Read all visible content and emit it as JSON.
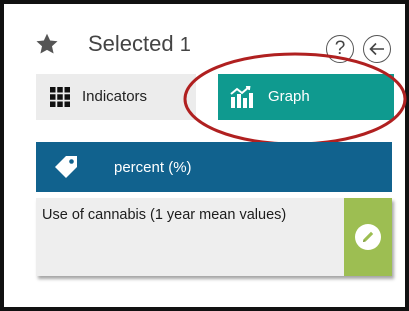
{
  "header": {
    "title": "Selected",
    "count": "1",
    "help_symbol": "?",
    "icons": {
      "star": "star-icon",
      "back": "arrow-left-icon"
    }
  },
  "tabs": [
    {
      "label": "Indicators",
      "icon": "grid-icon",
      "active": false
    },
    {
      "label": "Graph",
      "icon": "chart-icon",
      "active": true
    }
  ],
  "unit": {
    "label": "percent (%)",
    "icon": "tag-icon"
  },
  "indicator": {
    "label": "Use of cannabis (1 year mean values)",
    "action_icon": "pencil-icon"
  },
  "colors": {
    "graph_tab": "#0f9a8f",
    "unit_bar": "#11628e",
    "edit_button": "#9dbe52",
    "highlight_annotation": "#b02020"
  }
}
